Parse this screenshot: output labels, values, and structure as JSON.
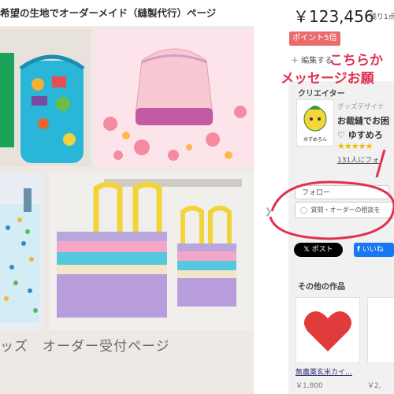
{
  "page": {
    "title": "希望の生地でオーダーメイド（縫製代行）ページ",
    "subtitle": "ッズ　オーダー受付ページ"
  },
  "product": {
    "price": "￥123,456",
    "stock": "残り1点"
  },
  "points_badge": "ポイント5倍",
  "edit_link": "＋ 編集する",
  "annotation": {
    "line1": "こちらか",
    "line2": "メッセージお願",
    "color": "#e0314e"
  },
  "creator": {
    "heading": "クリエイター",
    "description": "グッズデザイナ",
    "name": "お裁縫でお困",
    "shop": "♡ ゆすめろ",
    "stars": "★★★★★",
    "followers": "131人にフォ",
    "logo_text": "ゆずめろん"
  },
  "buttons": {
    "follow": "フォロー",
    "consult": "質問・オーダーの相談を",
    "x_post": "ポスト",
    "fb_like": "いいね"
  },
  "other_works": {
    "heading": "その他の作品",
    "items": [
      {
        "title": "無農薬玄米カイ…",
        "price": "￥1,800"
      },
      {
        "title": "",
        "price": "￥2,"
      }
    ]
  },
  "colors": {
    "accent_red": "#ea6b6b",
    "x_black": "#000000",
    "facebook_blue": "#1877f2",
    "star_gold": "#f5b800"
  }
}
